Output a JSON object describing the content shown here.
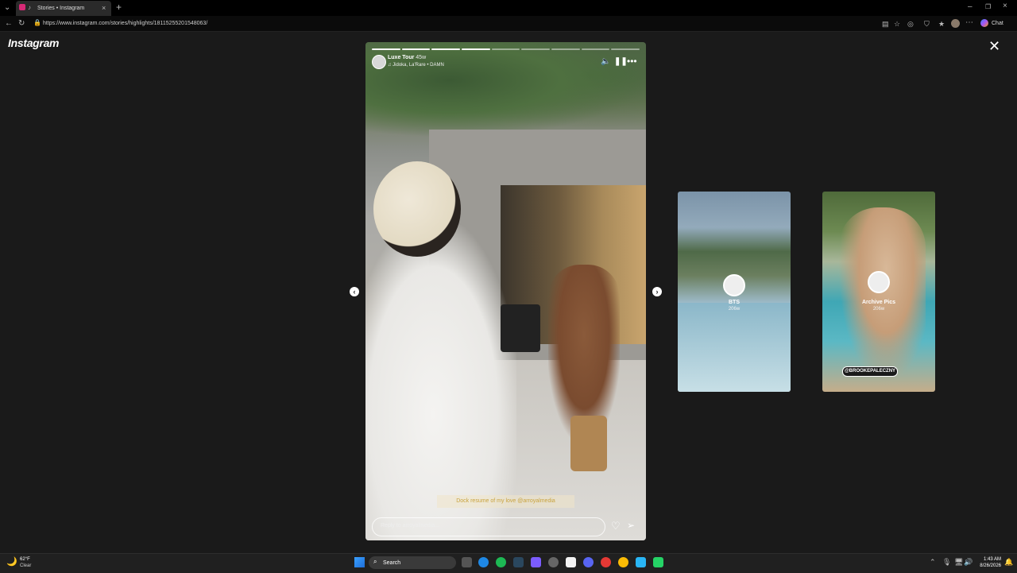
{
  "browser": {
    "tab_title": "Stories • Instagram",
    "url": "https://www.instagram.com/stories/highlights/18115255201548063/",
    "chat_label": "Chat"
  },
  "page": {
    "logo": "Instagram",
    "close_icon": "close-icon"
  },
  "story": {
    "username": "Luxe Tour",
    "time_ago": "45w",
    "audio": "Jidoka, La'Rare • DAMN",
    "caption": "Dock resume of my love @arroyalmedia",
    "reply_placeholder": "Reply to arroyalmedia...",
    "progress_total": 9,
    "progress_done": 4,
    "icons": [
      "mute-icon",
      "pause-icon",
      "more-icon",
      "heart-icon",
      "send-icon"
    ]
  },
  "highlights": [
    {
      "title": "BTS",
      "age": "206w"
    },
    {
      "title": "Archive Pics",
      "age": "206w",
      "tag": "@BROOKEPALECZNY"
    }
  ],
  "taskbar": {
    "weather_temp": "62°F",
    "weather_desc": "Clear",
    "search_label": "Search",
    "time": "1:43 AM",
    "date": "8/26/2026"
  }
}
